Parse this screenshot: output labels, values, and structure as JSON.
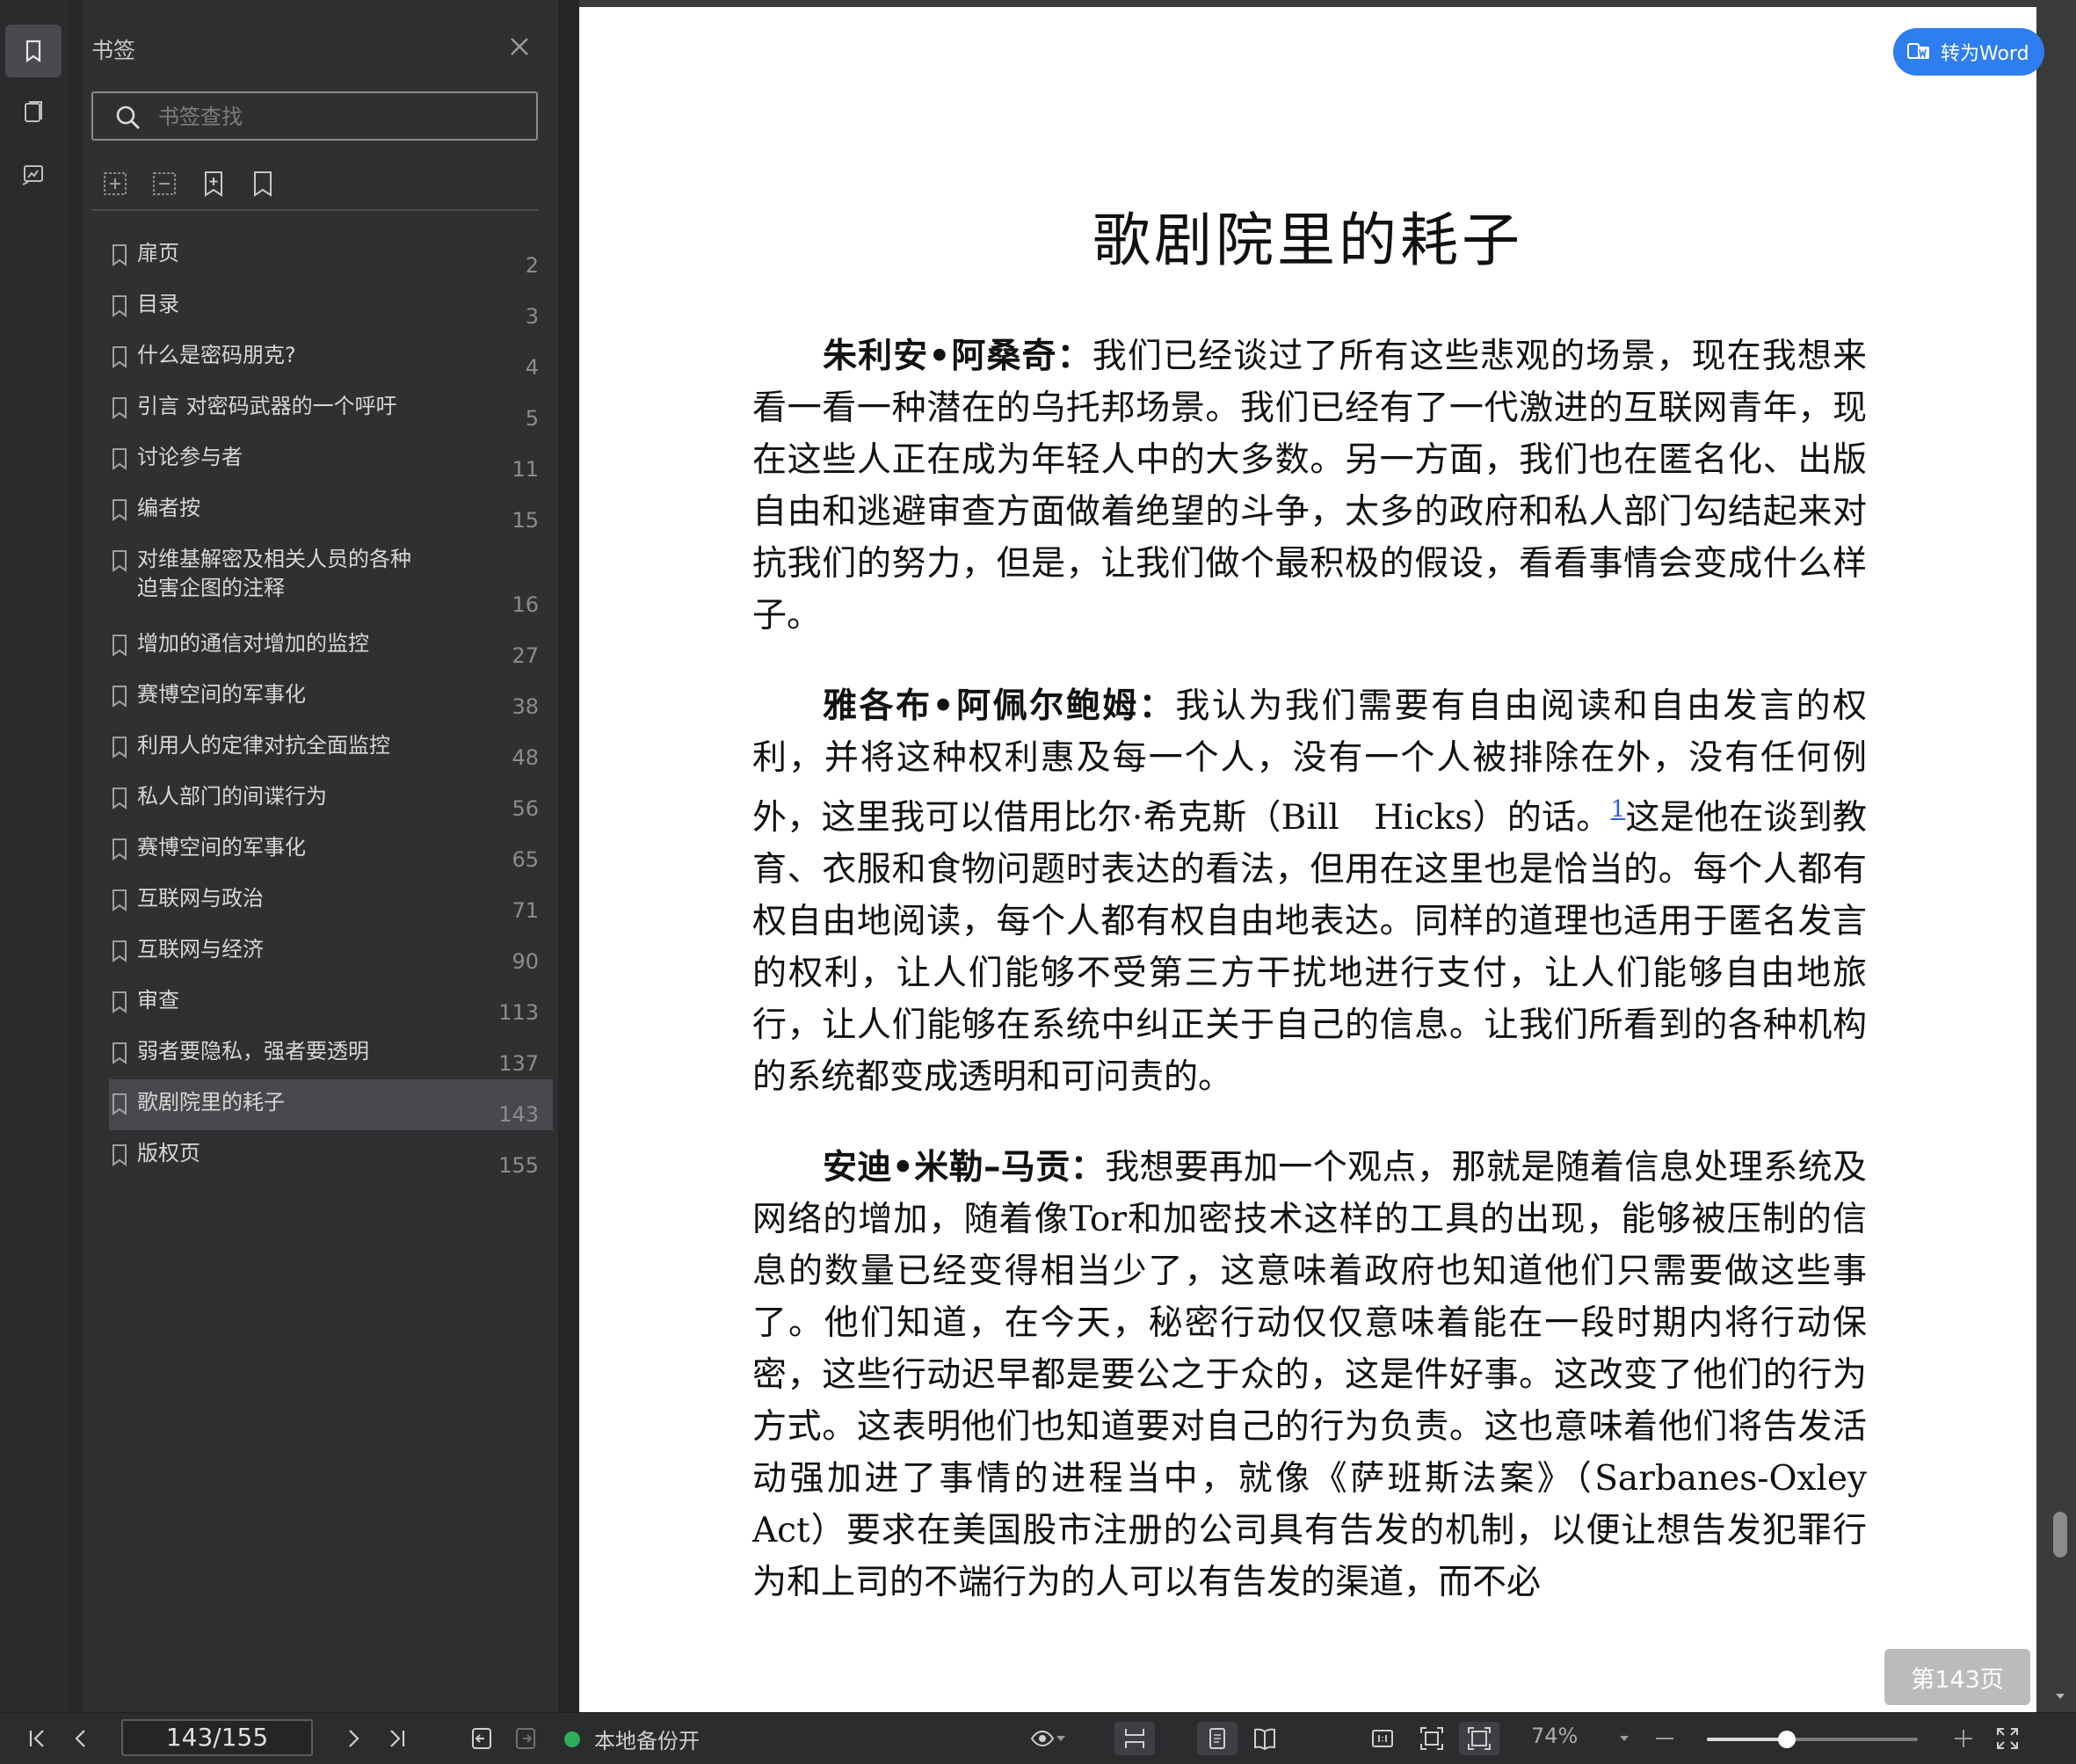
{
  "sidebar": {
    "title": "书签",
    "search_placeholder": "书签查找",
    "bookmarks": [
      {
        "label": "扉页",
        "page": "2"
      },
      {
        "label": "目录",
        "page": "3"
      },
      {
        "label": "什么是密码朋克?",
        "page": "4"
      },
      {
        "label": "引言 对密码武器的一个呼吁",
        "page": "5"
      },
      {
        "label": "讨论参与者",
        "page": "11"
      },
      {
        "label": "编者按",
        "page": "15"
      },
      {
        "label": "对维基解密及相关人员的各种迫害企图的注释",
        "page": "16"
      },
      {
        "label": "增加的通信对增加的监控",
        "page": "27"
      },
      {
        "label": "赛博空间的军事化",
        "page": "38"
      },
      {
        "label": "利用人的定律对抗全面监控",
        "page": "48"
      },
      {
        "label": "私人部门的间谍行为",
        "page": "56"
      },
      {
        "label": "赛博空间的军事化",
        "page": "65"
      },
      {
        "label": "互联网与政治",
        "page": "71"
      },
      {
        "label": "互联网与经济",
        "page": "90"
      },
      {
        "label": "审查",
        "page": "113"
      },
      {
        "label": "弱者要隐私，强者要透明",
        "page": "137"
      },
      {
        "label": "歌剧院里的耗子",
        "page": "143"
      },
      {
        "label": "版权页",
        "page": "155"
      }
    ],
    "active_index": 16
  },
  "document": {
    "title": "歌剧院里的耗子",
    "convert_button": "转为Word",
    "page_badge": "第143页",
    "paragraphs": [
      {
        "speaker": "朱利安•阿桑奇：",
        "text": "我们已经谈过了所有这些悲观的场景，现在我想来看一看一种潜在的乌托邦场景。我们已经有了一代激进的互联网青年，现在这些人正在成为年轻人中的大多数。另一方面，我们也在匿名化、出版自由和逃避审查方面做着绝望的斗争，太多的政府和私人部门勾结起来对抗我们的努力，但是，让我们做个最积极的假设，看看事情会变成什么样子。"
      },
      {
        "speaker": "雅各布•阿佩尔鲍姆：",
        "text": "我认为我们需要有自由阅读和自由发言的权利，并将这种权利惠及每一个人，没有一个人被排除在外，没有任何例外，这里我可以借用比尔·希克斯（Bill　Hicks）的话。",
        "footnote": "1",
        "text2": "这是他在谈到教育、衣服和食物问题时表达的看法，但用在这里也是恰当的。每个人都有权自由地阅读，每个人都有权自由地表达。同样的道理也适用于匿名发言的权利，让人们能够不受第三方干扰地进行支付，让人们能够自由地旅行，让人们能够在系统中纠正关于自己的信息。让我们所看到的各种机构的系统都变成透明和可问责的。"
      },
      {
        "speaker": "安迪•米勒–马贡：",
        "text": "我想要再加一个观点，那就是随着信息处理系统及网络的增加，随着像Tor和加密技术这样的工具的出现，能够被压制的信息的数量已经变得相当少了，这意味着政府也知道他们只需要做这些事了。他们知道，在今天，秘密行动仅仅意味着能在一段时期内将行动保密，这些行动迟早都是要公之于众的，这是件好事。这改变了他们的行为方式。这表明他们也知道要对自己的行为负责。这也意味着他们将告发活动强加进了事情的进程当中，就像《萨班斯法案》（Sarbanes-Oxley Act）要求在美国股市注册的公司具有告发的机制，以便让想告发犯罪行为和上司的不端行为的人可以有告发的渠道，而不必"
      }
    ]
  },
  "statusbar": {
    "page_indicator": "143/155",
    "backup_status": "本地备份开",
    "zoom": "74%",
    "zoom_level": 0.38
  }
}
